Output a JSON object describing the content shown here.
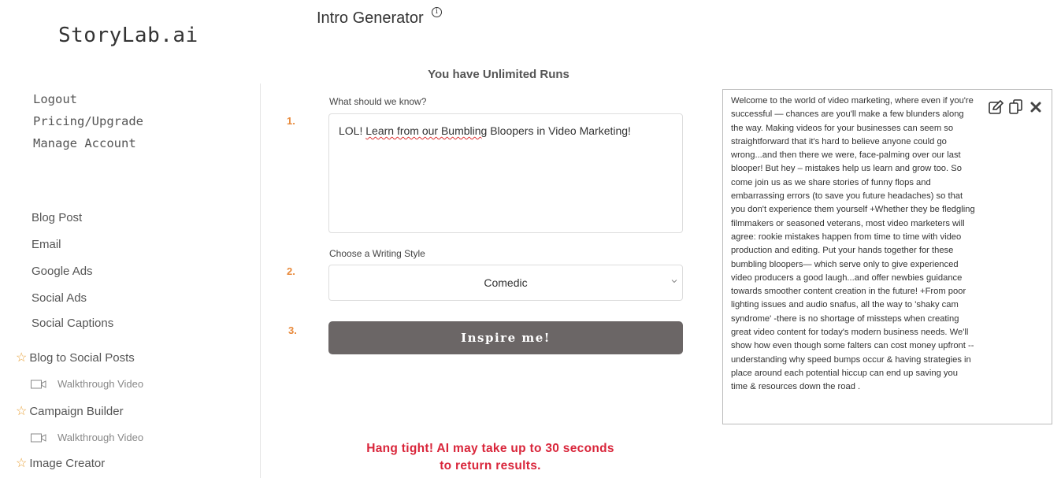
{
  "logo": "StoryLab.ai",
  "account_links": [
    "Logout",
    "Pricing/Upgrade",
    "Manage Account"
  ],
  "nav_links": [
    "Blog Post",
    "Email",
    "Google Ads",
    "Social Ads",
    "Social Captions"
  ],
  "featured": [
    {
      "label": "Blog to Social Posts",
      "video": "Walkthrough Video"
    },
    {
      "label": "Campaign Builder",
      "video": "Walkthrough Video"
    },
    {
      "label": "Image Creator"
    }
  ],
  "page_title": "Intro Generator",
  "info_glyph": "i",
  "runs_text": "You have Unlimited Runs",
  "steps": [
    "1.",
    "2.",
    "3."
  ],
  "form": {
    "know_label": "What should we know?",
    "know_value_parts": [
      "LOL! ",
      "Learn from our Bumbling",
      " Bloopers in Video Marketing!"
    ],
    "style_label": "Choose a Writing Style",
    "style_value": "Comedic",
    "inspire_label": "Inspire me!"
  },
  "wait_message": [
    "Hang tight! AI may take up to 30 seconds",
    "to return results."
  ],
  "output_text": "Welcome to the world of video marketing, where even if you're successful — chances are you'll make a few blunders along the way. Making videos for your businesses can seem so straightforward that it's hard to believe anyone could go wrong...and then there we were, face-palming over our last blooper! But hey – mistakes help us learn and grow too. So come join us as we share stories of funny flops and embarrassing errors (to save you future headaches) so that you don't experience them yourself +Whether they be fledgling filmmakers or seasoned veterans, most video marketers will agree: rookie mistakes happen from time to time with video production and editing. Put your hands together for these bumbling bloopers— which serve only to give experienced video producers a good laugh...and offer newbies guidance towards smoother content creation in the future! +From poor lighting issues and audio snafus, all the way to 'shaky cam syndrome' -there is no shortage of missteps when creating great video content for today's modern business needs. We'll show how even though some falters can cost money upfront -- understanding why speed bumps occur & having strategies in place around each potential hiccup can end up saving you time & resources down the road .",
  "output_icons": [
    "edit-icon",
    "copy-icon",
    "close-icon"
  ],
  "colors": {
    "accent_orange": "#e8893a",
    "star": "#e8a23a",
    "button": "#6b6666",
    "warning": "#d9253a"
  }
}
